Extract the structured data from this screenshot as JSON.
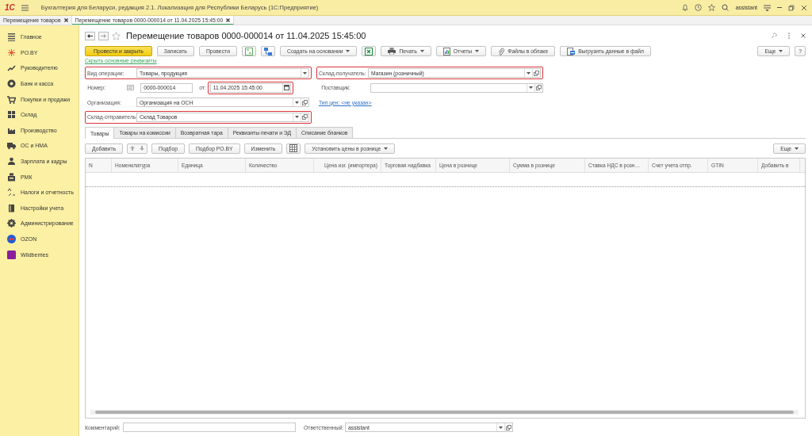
{
  "app": {
    "logo": "1С",
    "title": "Бухгалтерия для Беларуси, редакция 2.1. Локализация для Республики Беларусь  (1С:Предприятие)",
    "user": "assistant"
  },
  "open_tabs": [
    {
      "label": "Перемещение товаров",
      "selected": false
    },
    {
      "label": "Перемещение товаров 0000-000014 от 11.04.2025 15:45:00",
      "selected": true
    }
  ],
  "sidebar": {
    "items": [
      {
        "label": "Главное"
      },
      {
        "label": "PO.BY"
      },
      {
        "label": "Руководителю"
      },
      {
        "label": "Банк и касса"
      },
      {
        "label": "Покупки и продажи"
      },
      {
        "label": "Склад"
      },
      {
        "label": "Производство"
      },
      {
        "label": "ОС и НМА"
      },
      {
        "label": "Зарплата и кадры"
      },
      {
        "label": "РМК"
      },
      {
        "label": "Налоги и отчетность"
      },
      {
        "label": "Настройки учета"
      },
      {
        "label": "Администрирование"
      },
      {
        "label": "OZON"
      },
      {
        "label": "Wildberries"
      }
    ]
  },
  "document": {
    "title": "Перемещение товаров 0000-000014 от 11.04.2025 15:45:00",
    "toolbar": [
      {
        "kind": "primary",
        "label": "Провести и закрыть"
      },
      {
        "kind": "plain",
        "label": "Записать"
      },
      {
        "kind": "plain",
        "label": "Провести"
      },
      {
        "kind": "dtkt"
      },
      {
        "kind": "structure"
      },
      {
        "kind": "menu",
        "label": "Создать на основании"
      },
      {
        "kind": "excel"
      },
      {
        "kind": "print",
        "label": "Печать"
      },
      {
        "kind": "reports",
        "label": "Отчеты"
      },
      {
        "kind": "cloud",
        "label": "Файлы в облаке"
      },
      {
        "kind": "export",
        "label": "Выгрузить данные в файл"
      }
    ],
    "more_button": "Еще",
    "help_button": "?",
    "hide_link": "Скрыть основные реквизиты",
    "operation": {
      "label": "Вид операции:",
      "value": "Товары, продукция",
      "highlighted": true
    },
    "receiver": {
      "label": "Склад-получатель:",
      "value": "Магазин (розничный)",
      "highlighted": true
    },
    "number": {
      "label": "Номер:",
      "value": "0000-000014"
    },
    "date": {
      "label": "от:",
      "value": "11.04.2025 15:45:00",
      "highlighted": true
    },
    "supplier": {
      "label": "Поставщик:",
      "highlighted": false
    },
    "organization": {
      "label": "Организация:",
      "value": "Организация на ОСН",
      "highlighted": false
    },
    "price_type_link": "Тип цен: <не указан>",
    "sender": {
      "label": "Склад-отправитель:",
      "value": "Склад Товаров",
      "highlighted": true
    },
    "tabs": [
      {
        "label": "Товары",
        "selected": true
      },
      {
        "label": "Товары на комиссии",
        "selected": false
      },
      {
        "label": "Возвратная тара",
        "selected": false
      },
      {
        "label": "Реквизиты печати и ЭД",
        "selected": false
      },
      {
        "label": "Списание бланков",
        "selected": false
      }
    ],
    "table_toolbar": [
      {
        "kind": "plain",
        "label": "Добавить"
      },
      {
        "kind": "arrows"
      },
      {
        "kind": "plain",
        "label": "Подбор"
      },
      {
        "kind": "plain",
        "label": "Подбор PO.BY"
      },
      {
        "kind": "plain",
        "label": "Изменить"
      },
      {
        "kind": "grid"
      },
      {
        "kind": "menu",
        "label": "Установить цены в рознице"
      }
    ],
    "table_more": "Еще",
    "table": {
      "columns": [
        "N",
        "Номенклатура",
        "Единица",
        "Количество",
        "Цена изг. (импортера)",
        "Торговая надбавка",
        "Цена в рознице",
        "Сумма в рознице",
        "Ставка НДС в розн…",
        "Счет учета отпр.",
        "GTIN",
        "Добавить в"
      ]
    },
    "footer": {
      "comment_label": "Комментарий:",
      "responsible_label": "Ответственный:",
      "responsible_value": "assistant"
    }
  }
}
